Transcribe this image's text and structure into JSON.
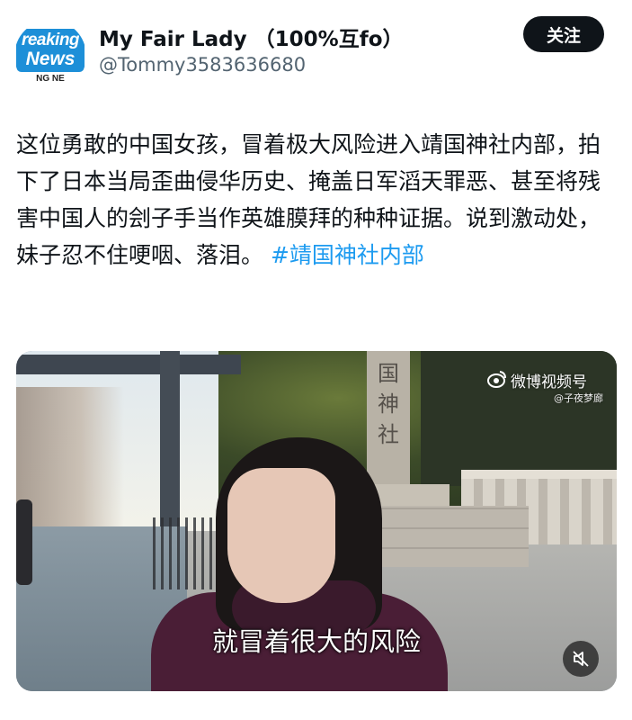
{
  "header": {
    "avatar_line1": "reaking",
    "avatar_line2": "News",
    "avatar_line3": "NG NE",
    "display_name": "My Fair Lady （100%互fo）",
    "handle": "@Tommy3583636680",
    "follow_label": "关注"
  },
  "post": {
    "text": "这位勇敢的中国女孩，冒着极大风险进入靖国神社内部，拍下了日本当局歪曲侵华历史、掩盖日军滔天罪恶、甚至将残害中国人的刽子手当作英雄膜拜的种种证据。说到激动处，妹子忍不住哽咽、落泪。",
    "hashtag": "#靖国神社内部"
  },
  "video": {
    "watermark": "微博视频号",
    "watermark_sub": "@子夜梦廊",
    "pillar_text": "国神社",
    "subtitle": "就冒着很大的风险",
    "mute_icon": "muted-speaker-icon"
  },
  "colors": {
    "accent": "#1d9bf0",
    "text": "#0f1419",
    "secondary": "#536471",
    "button_bg": "#0f1419"
  }
}
